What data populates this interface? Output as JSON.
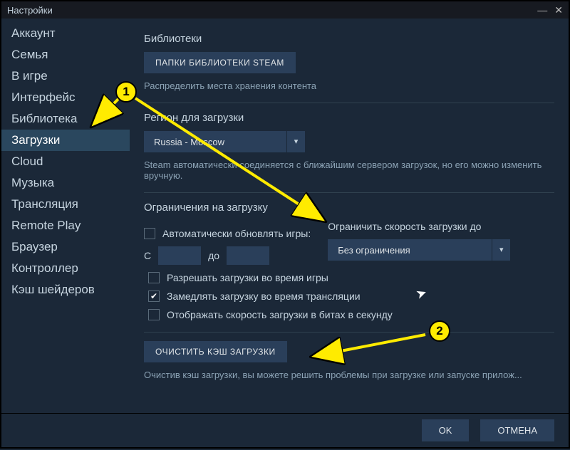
{
  "window": {
    "title": "Настройки",
    "minimize": "—",
    "close": "✕"
  },
  "sidebar": {
    "items": [
      {
        "label": "Аккаунт"
      },
      {
        "label": "Семья"
      },
      {
        "label": "В игре"
      },
      {
        "label": "Интерфейс"
      },
      {
        "label": "Библиотека"
      },
      {
        "label": "Загрузки",
        "active": true
      },
      {
        "label": "Cloud"
      },
      {
        "label": "Музыка"
      },
      {
        "label": "Трансляция"
      },
      {
        "label": "Remote Play"
      },
      {
        "label": "Браузер"
      },
      {
        "label": "Контроллер"
      },
      {
        "label": "Кэш шейдеров"
      }
    ]
  },
  "sections": {
    "libraries": {
      "title": "Библиотеки",
      "button": "ПАПКИ БИБЛИОТЕКИ STEAM",
      "helper": "Распределить места хранения контента"
    },
    "region": {
      "title": "Регион для загрузки",
      "value": "Russia - Moscow",
      "helper": "Steam автоматически соединяется с ближайшим сервером загрузок, но его можно изменить вручную."
    },
    "limits": {
      "title": "Ограничения на загрузку",
      "auto_update_label": "Автоматически обновлять игры:",
      "from_label": "С",
      "to_label": "до",
      "from_value": "",
      "to_value": "",
      "limit_label": "Ограничить скорость загрузки до",
      "limit_value": "Без ограничения",
      "opt_allow_ingame": "Разрешать загрузки во время игры",
      "opt_throttle_stream": "Замедлять загрузку во время трансляции",
      "opt_show_bits": "Отображать скорость загрузки в битах в секунду"
    },
    "clear_cache": {
      "button": "ОЧИСТИТЬ КЭШ ЗАГРУЗКИ",
      "helper": "Очистив кэш загрузки, вы можете решить проблемы при загрузке или запуске прилож..."
    }
  },
  "footer": {
    "ok": "OK",
    "cancel": "ОТМЕНА"
  },
  "annotations": {
    "badge1": "1",
    "badge2": "2"
  }
}
